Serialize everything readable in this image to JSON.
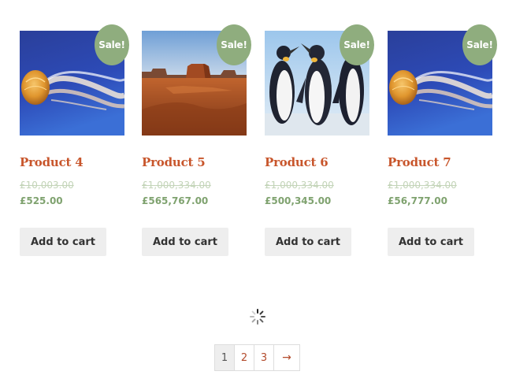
{
  "products": [
    {
      "title": "Product 4",
      "sale_badge": "Sale!",
      "regular_price": "£10,003.00",
      "sale_price": "£525.00",
      "button": "Add to cart",
      "image": "jellyfish"
    },
    {
      "title": "Product 5",
      "sale_badge": "Sale!",
      "regular_price": "£1,000,334.00",
      "sale_price": "£565,767.00",
      "button": "Add to cart",
      "image": "desert-mesa"
    },
    {
      "title": "Product 6",
      "sale_badge": "Sale!",
      "regular_price": "£1,000,334.00",
      "sale_price": "£500,345.00",
      "button": "Add to cart",
      "image": "penguins"
    },
    {
      "title": "Product 7",
      "sale_badge": "Sale!",
      "regular_price": "£1,000,334.00",
      "sale_price": "£56,777.00",
      "button": "Add to cart",
      "image": "jellyfish"
    }
  ],
  "pagination": {
    "pages": [
      "1",
      "2",
      "3"
    ],
    "current": "1",
    "next": "→"
  },
  "colors": {
    "sale_badge": "#8fad7e",
    "title": "#c8562c",
    "sale_price": "#7fa26f",
    "regular_price": "#c3d4b8",
    "button_bg": "#eeeeee"
  },
  "loading_icon": "spinner-icon"
}
